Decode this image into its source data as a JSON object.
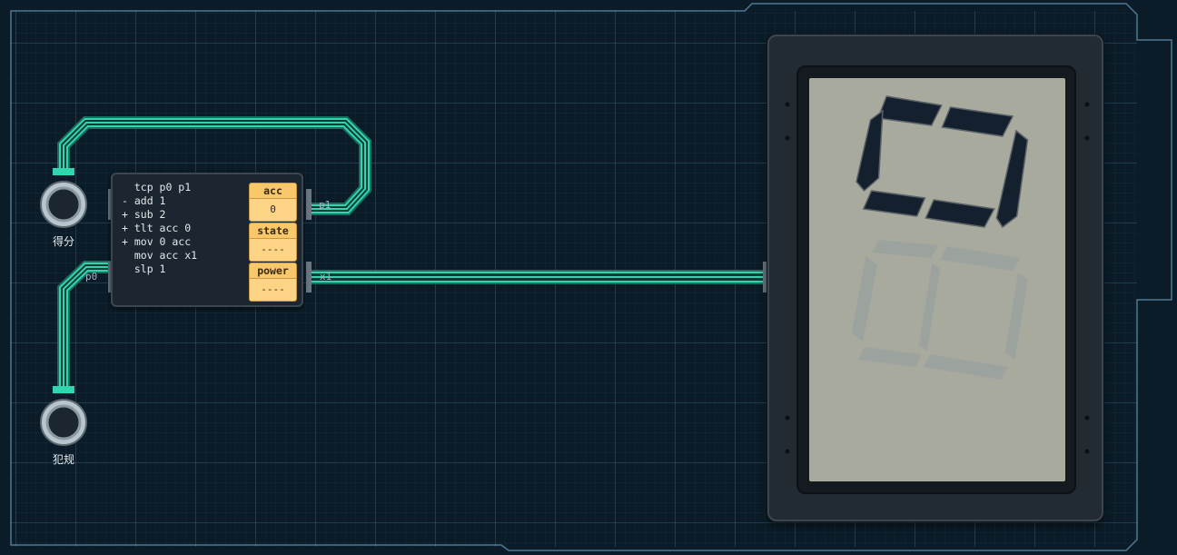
{
  "microcontroller": {
    "code": [
      "  tcp p0 p1",
      "- add 1",
      "+ sub 2",
      "+ tlt acc 0",
      "+ mov 0 acc",
      "  mov acc x1",
      "  slp 1"
    ],
    "registers": [
      {
        "name": "acc",
        "value": "0"
      },
      {
        "name": "state",
        "value": "----"
      },
      {
        "name": "power",
        "value": "----"
      }
    ],
    "pins": {
      "p0": "p0",
      "p1": "p1",
      "x1": "x1"
    }
  },
  "buttons": [
    {
      "label": "得分"
    },
    {
      "label": "犯规"
    }
  ],
  "display": {
    "digit_value": "0"
  },
  "colors": {
    "wire": "#2fd6b0",
    "register": "#f9c86a",
    "lcd": "#a8aa9e",
    "segment_on": "#14202e"
  }
}
